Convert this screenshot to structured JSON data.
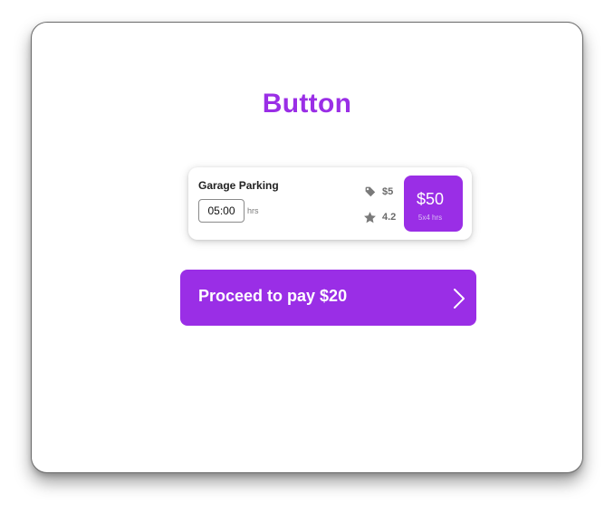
{
  "header": {
    "title": "Button"
  },
  "parking_card": {
    "title": "Garage Parking",
    "time_value": "05:00",
    "hours_unit": "hrs",
    "rate": "$5",
    "rating": "4.2",
    "total": {
      "amount": "$50",
      "breakdown": "5x4 hrs"
    },
    "icons": {
      "rate": "price-tag-icon",
      "rating": "star-icon"
    }
  },
  "cta": {
    "label": "Proceed to pay $20",
    "icon": "chevron-right-icon"
  },
  "colors": {
    "accent": "#9a2ee6",
    "muted": "#6a6a6a"
  }
}
